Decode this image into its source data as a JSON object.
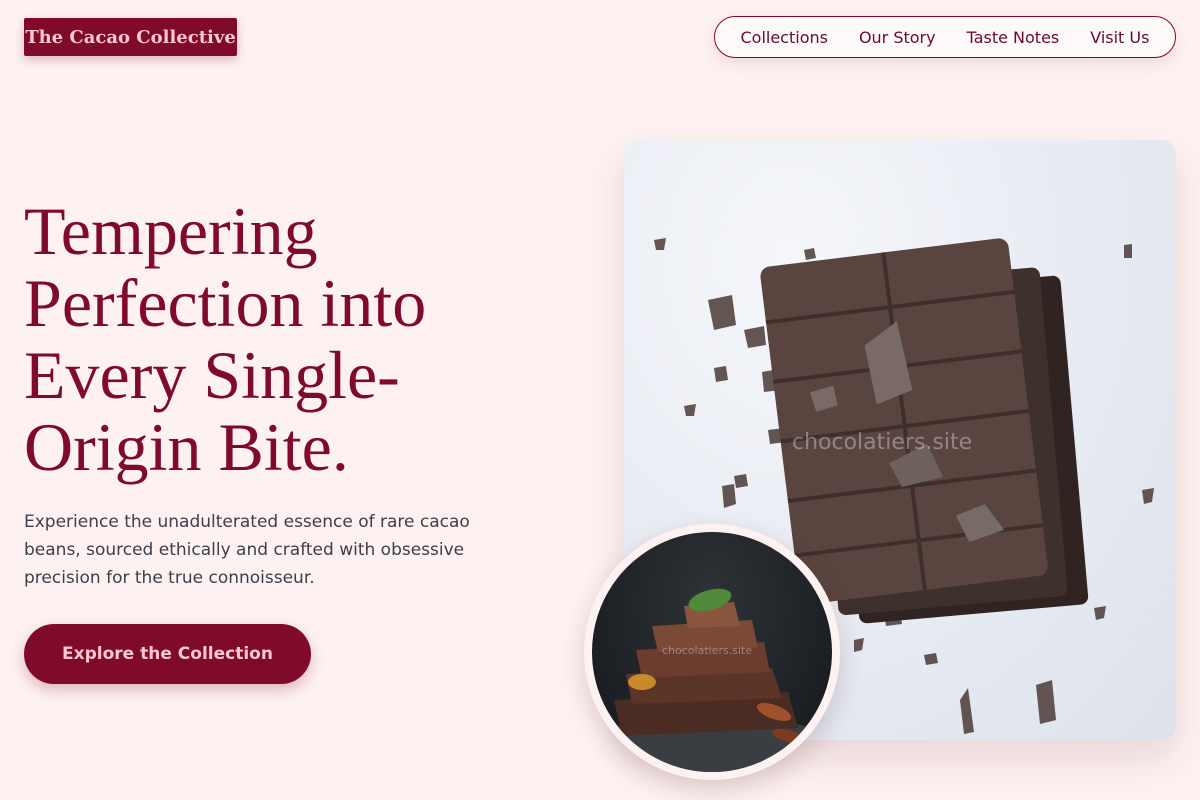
{
  "brand": {
    "name": "The Cacao Collective"
  },
  "nav": {
    "items": [
      {
        "label": "Collections"
      },
      {
        "label": "Our Story"
      },
      {
        "label": "Taste Notes"
      },
      {
        "label": "Visit Us"
      }
    ]
  },
  "hero": {
    "headline": "Tempering Perfection into Every Single-Origin Bite.",
    "subcopy": "Experience the unadulterated essence of rare cacao beans, sourced ethically and crafted with obsessive precision for the true connoisseur.",
    "cta_label": "Explore the Collection"
  },
  "images": {
    "main_watermark": "chocolatiers.site",
    "circle_watermark": "chocolatiers.site"
  },
  "colors": {
    "brand": "#7f0a2a",
    "brand_text": "#f7c9cf",
    "background": "#fdf2f1",
    "body_text": "#3c3f4a"
  }
}
